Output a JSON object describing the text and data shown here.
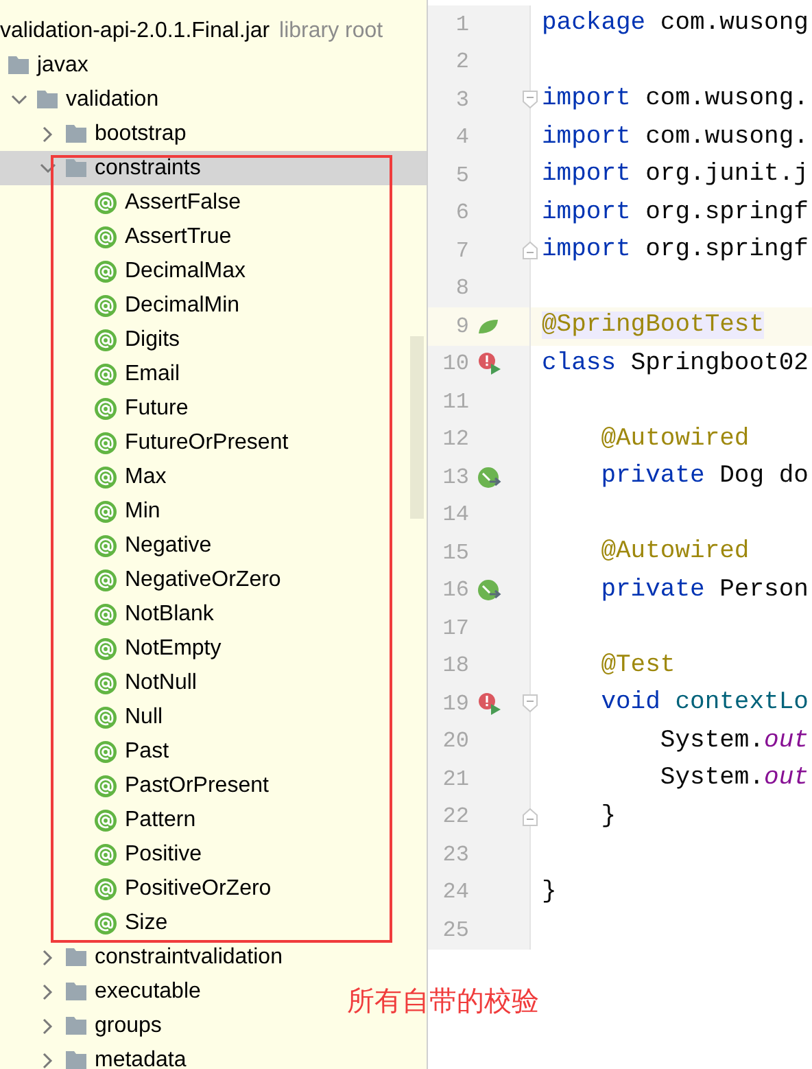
{
  "project_tree": {
    "root": {
      "name": "validation-api-2.0.1.Final.jar",
      "hint": "library root"
    },
    "items": [
      {
        "name": "javax",
        "kind": "package",
        "selected": false,
        "children": [
          {
            "name": "validation",
            "kind": "package",
            "expanded": true,
            "selected": false,
            "children": [
              {
                "name": "bootstrap",
                "kind": "package",
                "expanded": false,
                "selected": false
              },
              {
                "name": "constraints",
                "kind": "package",
                "expanded": true,
                "selected": true,
                "children": [
                  {
                    "name": "AssertFalse",
                    "kind": "annotation",
                    "selected": false
                  },
                  {
                    "name": "AssertTrue",
                    "kind": "annotation",
                    "selected": false
                  },
                  {
                    "name": "DecimalMax",
                    "kind": "annotation",
                    "selected": false
                  },
                  {
                    "name": "DecimalMin",
                    "kind": "annotation",
                    "selected": false
                  },
                  {
                    "name": "Digits",
                    "kind": "annotation",
                    "selected": false
                  },
                  {
                    "name": "Email",
                    "kind": "annotation",
                    "selected": false
                  },
                  {
                    "name": "Future",
                    "kind": "annotation",
                    "selected": false
                  },
                  {
                    "name": "FutureOrPresent",
                    "kind": "annotation",
                    "selected": false
                  },
                  {
                    "name": "Max",
                    "kind": "annotation",
                    "selected": false
                  },
                  {
                    "name": "Min",
                    "kind": "annotation",
                    "selected": false
                  },
                  {
                    "name": "Negative",
                    "kind": "annotation",
                    "selected": false
                  },
                  {
                    "name": "NegativeOrZero",
                    "kind": "annotation",
                    "selected": false
                  },
                  {
                    "name": "NotBlank",
                    "kind": "annotation",
                    "selected": false
                  },
                  {
                    "name": "NotEmpty",
                    "kind": "annotation",
                    "selected": false
                  },
                  {
                    "name": "NotNull",
                    "kind": "annotation",
                    "selected": false
                  },
                  {
                    "name": "Null",
                    "kind": "annotation",
                    "selected": false
                  },
                  {
                    "name": "Past",
                    "kind": "annotation",
                    "selected": false
                  },
                  {
                    "name": "PastOrPresent",
                    "kind": "annotation",
                    "selected": false
                  },
                  {
                    "name": "Pattern",
                    "kind": "annotation",
                    "selected": false
                  },
                  {
                    "name": "Positive",
                    "kind": "annotation",
                    "selected": false
                  },
                  {
                    "name": "PositiveOrZero",
                    "kind": "annotation",
                    "selected": false
                  },
                  {
                    "name": "Size",
                    "kind": "annotation",
                    "selected": false
                  }
                ]
              },
              {
                "name": "constraintvalidation",
                "kind": "package",
                "expanded": false,
                "selected": false
              },
              {
                "name": "executable",
                "kind": "package",
                "expanded": false,
                "selected": false
              },
              {
                "name": "groups",
                "kind": "package",
                "expanded": false,
                "selected": false
              },
              {
                "name": "metadata",
                "kind": "package",
                "expanded": false,
                "selected": false
              }
            ]
          }
        ]
      }
    ]
  },
  "editor": {
    "lines": [
      {
        "number": "1",
        "current": false,
        "tokens": [
          {
            "text": "package",
            "kind": "keyword"
          },
          {
            "text": " com.wusong",
            "kind": "plain"
          }
        ]
      },
      {
        "number": "2",
        "current": false
      },
      {
        "number": "3",
        "current": false,
        "fold_marker": {
          "kind": "start"
        },
        "tokens": [
          {
            "text": "import",
            "kind": "keyword"
          },
          {
            "text": " com.wusong.",
            "kind": "plain"
          }
        ]
      },
      {
        "number": "4",
        "current": false,
        "tokens": [
          {
            "text": "import",
            "kind": "keyword"
          },
          {
            "text": " com.wusong.",
            "kind": "plain"
          }
        ]
      },
      {
        "number": "5",
        "current": false,
        "tokens": [
          {
            "text": "import",
            "kind": "keyword"
          },
          {
            "text": " org.junit.j",
            "kind": "plain"
          }
        ]
      },
      {
        "number": "6",
        "current": false,
        "tokens": [
          {
            "text": "import",
            "kind": "keyword"
          },
          {
            "text": " org.springf",
            "kind": "plain"
          }
        ]
      },
      {
        "number": "7",
        "current": false,
        "fold_marker": {
          "kind": "end"
        },
        "tokens": [
          {
            "text": "import",
            "kind": "keyword"
          },
          {
            "text": " org.springf",
            "kind": "plain"
          }
        ]
      },
      {
        "number": "8",
        "current": false
      },
      {
        "number": "9",
        "current": true,
        "gutter_icon": {
          "kind": "spring"
        },
        "tokens": [
          {
            "text": "@SpringBootTest",
            "kind": "annotation-highlighted"
          }
        ]
      },
      {
        "number": "10",
        "current": false,
        "gutter_icon": {
          "kind": "run-error"
        },
        "tokens": [
          {
            "text": "class",
            "kind": "keyword"
          },
          {
            "text": " Springboot02",
            "kind": "plain"
          }
        ]
      },
      {
        "number": "11",
        "current": false
      },
      {
        "number": "12",
        "current": false,
        "tokens": [
          {
            "text": "    @Autowired",
            "kind": "annotation"
          }
        ]
      },
      {
        "number": "13",
        "current": false,
        "gutter_icon": {
          "kind": "bean"
        },
        "tokens": [
          {
            "text": "    private",
            "kind": "keyword"
          },
          {
            "text": " Dog do",
            "kind": "plain"
          }
        ]
      },
      {
        "number": "14",
        "current": false
      },
      {
        "number": "15",
        "current": false,
        "tokens": [
          {
            "text": "    @Autowired",
            "kind": "annotation"
          }
        ]
      },
      {
        "number": "16",
        "current": false,
        "gutter_icon": {
          "kind": "bean"
        },
        "tokens": [
          {
            "text": "    private",
            "kind": "keyword"
          },
          {
            "text": " Person",
            "kind": "plain"
          }
        ]
      },
      {
        "number": "17",
        "current": false
      },
      {
        "number": "18",
        "current": false,
        "tokens": [
          {
            "text": "    @Test",
            "kind": "annotation"
          }
        ]
      },
      {
        "number": "19",
        "current": false,
        "gutter_icon": {
          "kind": "run-error"
        },
        "fold_marker": {
          "kind": "start"
        },
        "tokens": [
          {
            "text": "    void",
            "kind": "keyword"
          },
          {
            "text": " contextLo",
            "kind": "method"
          }
        ]
      },
      {
        "number": "20",
        "current": false,
        "tokens": [
          {
            "text": "        System.",
            "kind": "plain"
          },
          {
            "text": "out",
            "kind": "field"
          }
        ]
      },
      {
        "number": "21",
        "current": false,
        "tokens": [
          {
            "text": "        System.",
            "kind": "plain"
          },
          {
            "text": "out",
            "kind": "field"
          }
        ]
      },
      {
        "number": "22",
        "current": false,
        "fold_marker": {
          "kind": "end"
        },
        "tokens": [
          {
            "text": "    }",
            "kind": "plain"
          }
        ]
      },
      {
        "number": "23",
        "current": false
      },
      {
        "number": "24",
        "current": false,
        "tokens": [
          {
            "text": "}",
            "kind": "plain"
          }
        ]
      },
      {
        "number": "25",
        "current": false
      }
    ]
  },
  "annotation": {
    "text": "所有自带的校验"
  }
}
